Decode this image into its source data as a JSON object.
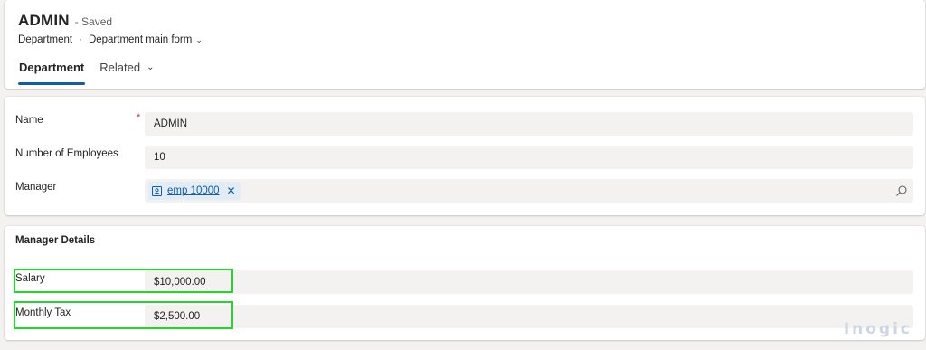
{
  "header": {
    "title": "ADMIN",
    "saved_status": "- Saved",
    "entity": "Department",
    "separator": "·",
    "form_name": "Department main form",
    "tabs": [
      {
        "label": "Department",
        "active": true
      },
      {
        "label": "Related",
        "active": false
      }
    ]
  },
  "fields": {
    "name": {
      "label": "Name",
      "required_marker": "*",
      "value": "ADMIN"
    },
    "employees": {
      "label": "Number of Employees",
      "value": "10"
    },
    "manager": {
      "label": "Manager",
      "value": "emp 10000",
      "remove": "✕"
    }
  },
  "manager_details": {
    "title": "Manager Details",
    "salary": {
      "label": "Salary",
      "value": "$10,000.00"
    },
    "monthly_tax": {
      "label": "Monthly Tax",
      "value": "$2,500.00"
    }
  },
  "colors": {
    "accent": "#115ea3",
    "highlight": "#22d62c",
    "required": "#c4314b"
  },
  "watermark": "Inogic"
}
